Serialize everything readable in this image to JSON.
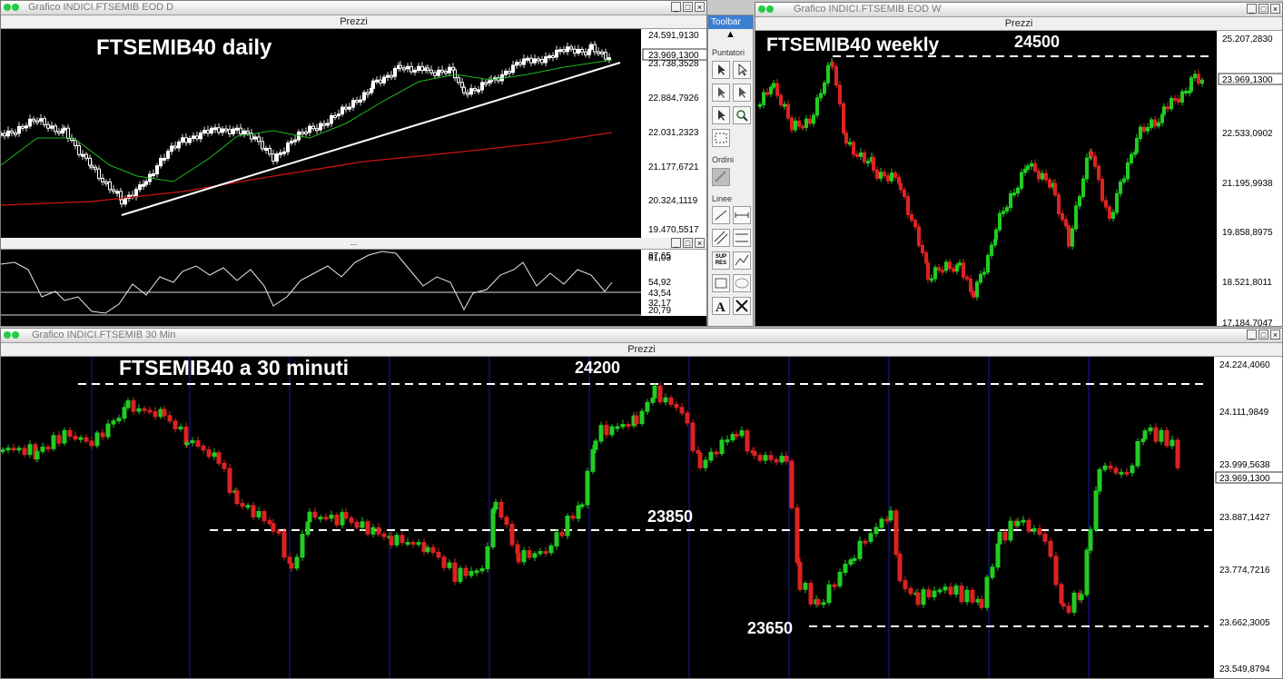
{
  "window_daily": {
    "title": "Grafico INDICI.FTSEMIB EOD D",
    "subtitle": "Prezzi",
    "label": "FTSEMIB40 daily",
    "price_axis": [
      "24.591,9130",
      "23.738,3528",
      "22.884,7926",
      "22.031,2323",
      "21.177,6721",
      "20.324,1119",
      "19.470,5517"
    ],
    "last_price": "23.969,1300",
    "osc_axis": [
      "87,65",
      "81,03",
      "54,92",
      "43,54",
      "32,17",
      "20,79"
    ]
  },
  "window_weekly": {
    "title": "Grafico INDICI.FTSEMIB EOD W",
    "subtitle": "Prezzi",
    "label": "FTSEMIB40 weekly",
    "level_label": "24500",
    "price_axis": [
      "25.207,2830",
      "22.533,0902",
      "21.195,9938",
      "19.858,8975",
      "18.521,8011",
      "17.184,7047"
    ],
    "last_price": "23.969,1300"
  },
  "window_30min": {
    "title": "Grafico INDICI.FTSEMIB 30 Min",
    "subtitle": "Prezzi",
    "label": "FTSEMIB40 a 30 minuti",
    "levels": [
      "24200",
      "23850",
      "23650"
    ],
    "price_axis": [
      "24.224,4060",
      "24.111,9849",
      "23.999,5638",
      "23.887,1427",
      "23.774,7216",
      "23.662,3005",
      "23.549,8794"
    ],
    "last_price": "23.969,1300"
  },
  "toolbar": {
    "title": "Toolbar",
    "sections": [
      "Puntatori",
      "Ordini",
      "Linee"
    ],
    "tool_texts": [
      "SUP",
      "RES"
    ]
  },
  "colors": {
    "background": "#000000",
    "bull_candle": "#22cc22",
    "bear_candle": "#dd2222",
    "ma_short": "#1fb91f",
    "ma_long": "#cc1111",
    "trendline": "#ffffff",
    "session_line": "#1a1aaa"
  },
  "icons": [
    "pointer-icon",
    "pointer-select-icon",
    "zoom-icon",
    "marquee-icon",
    "order-icon",
    "line-icon",
    "hline-icon",
    "channel-icon",
    "parallel-icon",
    "support-resistance-icon",
    "polyline-icon",
    "rectangle-icon",
    "ellipse-icon",
    "text-icon",
    "delete-icon"
  ]
}
